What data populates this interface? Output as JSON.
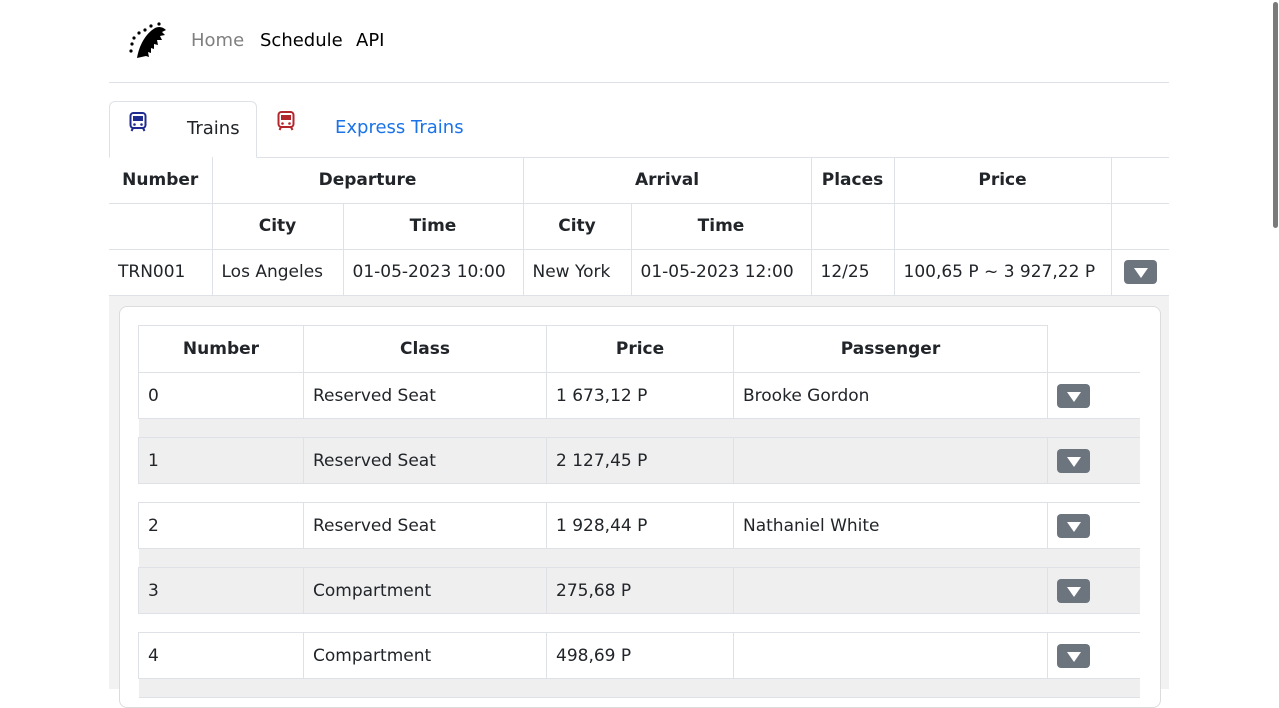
{
  "nav": {
    "home": "Home",
    "schedule": "Schedule",
    "api": "API"
  },
  "tabs": {
    "trains": "Trains",
    "express": "Express Trains",
    "trains_icon": "train-icon-blue",
    "express_icon": "train-icon-red"
  },
  "main_table": {
    "headers": {
      "number": "Number",
      "departure": "Departure",
      "arrival": "Arrival",
      "places": "Places",
      "price": "Price",
      "dep_city": "City",
      "dep_time": "Time",
      "arr_city": "City",
      "arr_time": "Time"
    },
    "row": {
      "number": "TRN001",
      "dep_city": "Los Angeles",
      "dep_time": "01-05-2023 10:00",
      "arr_city": "New York",
      "arr_time": "01-05-2023 12:00",
      "places": "12/25",
      "price": "100,65 P ~ 3 927,22 P"
    }
  },
  "seats_table": {
    "headers": {
      "number": "Number",
      "class": "Class",
      "price": "Price",
      "passenger": "Passenger"
    },
    "rows": [
      {
        "number": "0",
        "class": "Reserved Seat",
        "price": "1 673,12 P",
        "passenger": "Brooke Gordon"
      },
      {
        "number": "1",
        "class": "Reserved Seat",
        "price": "2 127,45 P",
        "passenger": ""
      },
      {
        "number": "2",
        "class": "Reserved Seat",
        "price": "1 928,44 P",
        "passenger": "Nathaniel White"
      },
      {
        "number": "3",
        "class": "Compartment",
        "price": "275,68 P",
        "passenger": ""
      },
      {
        "number": "4",
        "class": "Compartment",
        "price": "498,69 P",
        "passenger": ""
      }
    ]
  },
  "colors": {
    "link": "#1a73e8",
    "muted": "#7f7f7f",
    "button": "#6c757d",
    "train_blue": "#1f2b8f",
    "train_red": "#b3262c"
  }
}
